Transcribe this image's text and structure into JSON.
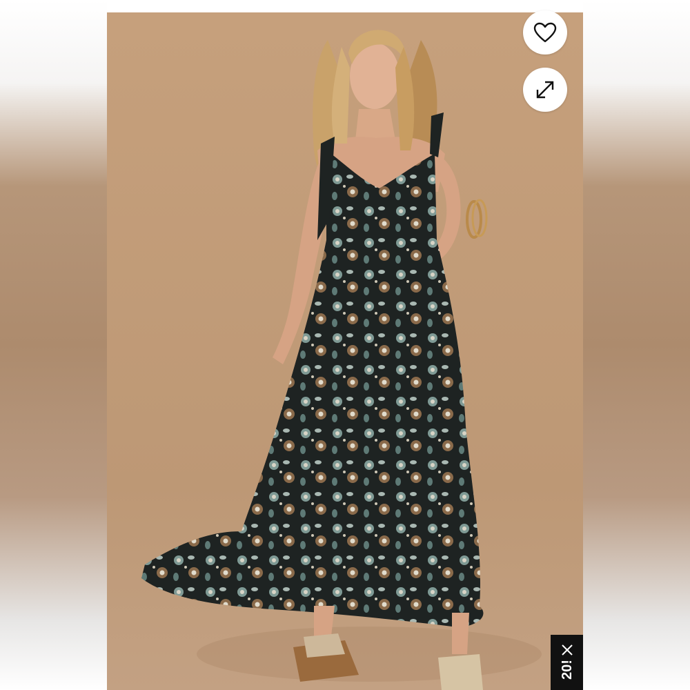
{
  "product_image": {
    "subject": "model-wearing-floral-print-maxi-dress",
    "background_color": "#c09b78",
    "dress_colors": [
      "#1d2220",
      "#7f9a95",
      "#8a6a4a",
      "#d8d4c6"
    ]
  },
  "actions": {
    "favorite_icon": "heart-icon",
    "expand_icon": "expand-icon"
  },
  "promo_banner": {
    "text": "20!",
    "close_icon": "close-icon",
    "background": "#111111"
  }
}
